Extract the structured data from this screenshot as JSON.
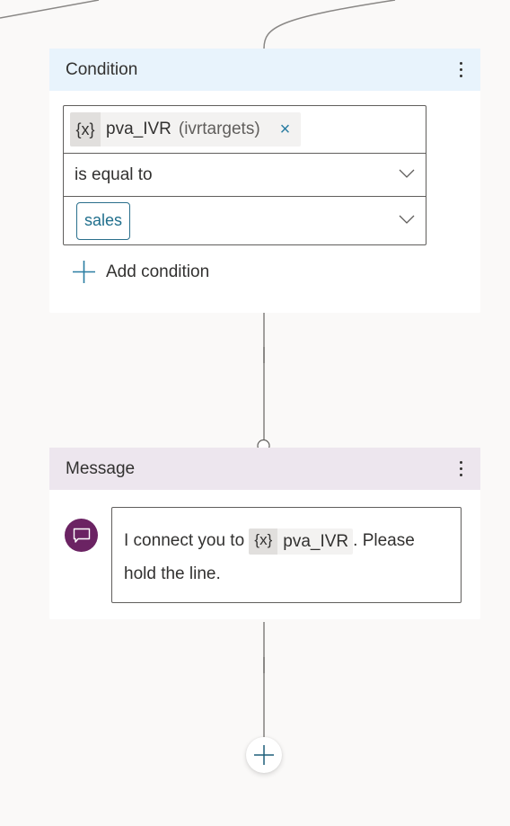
{
  "condition_node": {
    "title": "Condition",
    "more_icon": "more-vertical-icon",
    "variable": {
      "badge": "{x}",
      "name": "pva_IVR",
      "type": "(ivrtargets)",
      "remove_icon": "×"
    },
    "operator": {
      "selected": "is equal to",
      "icon": "chevron-down-icon"
    },
    "value": {
      "selected": "sales",
      "icon": "chevron-down-icon"
    },
    "add_condition_label": "Add condition"
  },
  "message_node": {
    "title": "Message",
    "more_icon": "more-vertical-icon",
    "icon": "chat-bubble-icon",
    "text_before": "I connect you to ",
    "variable": {
      "badge": "{x}",
      "name": "pva_IVR"
    },
    "text_after": ".  Please hold the line."
  },
  "add_node_button": {
    "icon": "plus-icon"
  },
  "colors": {
    "canvas": "#faf9f8",
    "condition_header": "#e8f3fc",
    "message_header": "#ede6ee",
    "message_icon": "#6b2363",
    "accent": "#2a7da2"
  }
}
